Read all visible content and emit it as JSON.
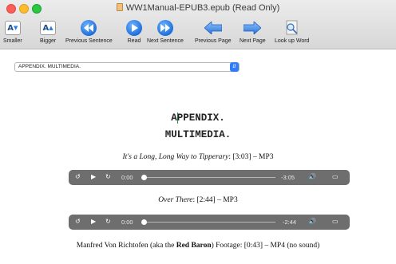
{
  "window": {
    "title": "WW1Manual-EPUB3.epub (Read Only)"
  },
  "toolbar": {
    "smaller": "Smaller",
    "bigger": "Bigger",
    "previous_sentence": "Previous Sentence",
    "read": "Read",
    "next_sentence": "Next Sentence",
    "previous_page": "Previous Page",
    "next_page": "Next Page",
    "look_up_word": "Look up Word",
    "aa_glyph": "A"
  },
  "section_select": {
    "value": "APPENDIX. MULTIMEDIA."
  },
  "content": {
    "heading_line1": "APPENDIX.",
    "heading_line2": "MULTIMEDIA.",
    "item1_title": "It's a Long, Long Way to Tipperary",
    "item1_meta": ": [3:03] – MP3",
    "item2_title": "Over There",
    "item2_meta": ": [2:44] – MP3",
    "item3_prefix": "Manfred Von Richtofen (aka the ",
    "item3_bold": "Red Baron",
    "item3_suffix": ") Footage: [0:43] – MP4 (no sound)"
  },
  "players": [
    {
      "current": "0:00",
      "remaining": "-3:05",
      "progress": 0
    },
    {
      "current": "0:00",
      "remaining": "-2:44",
      "progress": 0
    }
  ],
  "icons": {
    "rewind": "rewind-15-icon",
    "play": "play-icon",
    "forward": "forward-15-icon",
    "volume": "volume-icon",
    "airplay": "airplay-icon"
  },
  "colors": {
    "accent": "#2f7cf6",
    "player_bg": "#6e6e6e",
    "cursor": "#1aa043"
  }
}
